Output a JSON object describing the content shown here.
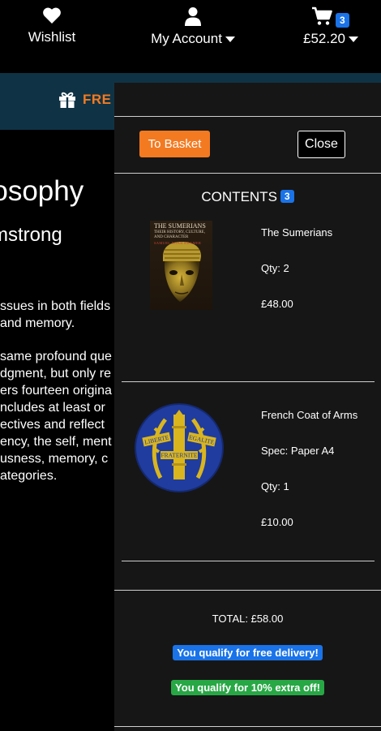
{
  "nav": {
    "wishlist": {
      "label": "Wishlist",
      "icon": "heart-icon"
    },
    "account": {
      "label": "My Account",
      "icon": "user-icon"
    },
    "cart": {
      "total": "£52.20",
      "count": "3",
      "icon": "cart-icon"
    }
  },
  "promo": {
    "icon": "gift-icon",
    "text": "FRE"
  },
  "article": {
    "title": "Philosophy",
    "author": "Armstrong",
    "paragraph1": [
      "ssues in both fields",
      "and memory."
    ],
    "paragraph2": [
      "same profound que",
      "dgment, but only re",
      "ers fourteen origina",
      "ncludes at least or",
      "ectives and reflect",
      "ency, the self, ment",
      "usness, memory, c",
      "ategories."
    ]
  },
  "cart": {
    "to_basket": "To Basket",
    "close": "Close",
    "contents_label": "CONTENTS",
    "contents_count": "3",
    "items": [
      {
        "title": "The Sumerians",
        "qty": "Qty: 2",
        "price": "£48.00",
        "cover_title": "THE SUMERIANS",
        "cover_subtitle": "THEIR HISTORY, CULTURE, AND CHARACTER",
        "cover_author": "SAMUEL NOAH KRAMER"
      },
      {
        "title": "French Coat of Arms",
        "spec": "Spec: Paper A4",
        "qty": "Qty: 1",
        "price": "£10.00",
        "emblem_words": [
          "LIBERTE",
          "EGALITE",
          "FRATERNITE"
        ]
      }
    ],
    "total": "TOTAL: £58.00",
    "free_delivery": "You qualify for free delivery!",
    "extra_off": "You qualify for 10% extra off!"
  },
  "colors": {
    "accent_orange": "#f37a21",
    "badge_blue": "#1a73e8",
    "success_green": "#28a745",
    "promo_band": "#0f3345",
    "drawer_bg": "#161616"
  }
}
